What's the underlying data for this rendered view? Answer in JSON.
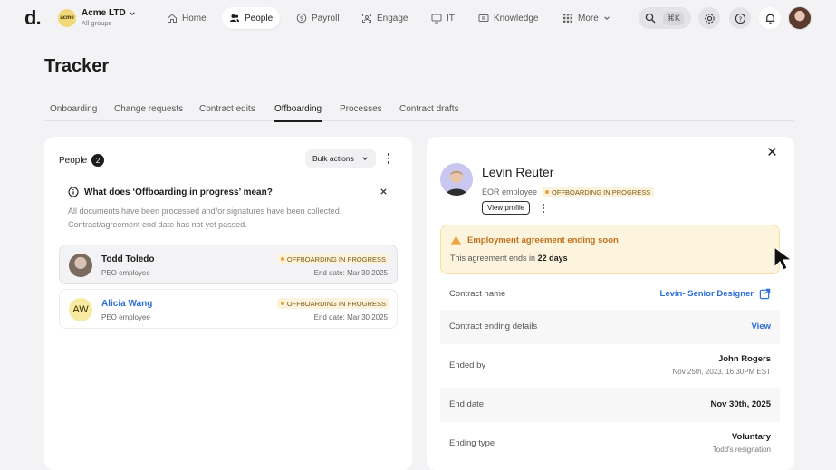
{
  "nav": {
    "logo": "d.",
    "org_badge": "acme",
    "org_name": "Acme LTD",
    "org_sub": "All groups",
    "items": [
      {
        "label": "Home"
      },
      {
        "label": "People"
      },
      {
        "label": "Payroll"
      },
      {
        "label": "Engage"
      },
      {
        "label": "IT"
      },
      {
        "label": "Knowledge"
      },
      {
        "label": "More"
      }
    ],
    "search_shortcut": "⌘K"
  },
  "page": {
    "title": "Tracker",
    "tabs": [
      "Onboarding",
      "Change requests",
      "Contract edits",
      "Offboarding",
      "Processes",
      "Contract drafts"
    ],
    "active_tab": "Offboarding"
  },
  "people_panel": {
    "label": "People",
    "count": "2",
    "bulk_actions": "Bulk actions",
    "info_title": "What does ‘Offboarding in progress’ mean?",
    "info_line1": "All documents have been processed and/or signatures have been collected.",
    "info_line2": "Contract/agreement end date has not yet passed.",
    "people": [
      {
        "initials": "",
        "name": "Todd Toledo",
        "role": "PEO employee",
        "status": "OFFBOARDING IN PROGRESS",
        "end_date": "End date: Mar 30 2025"
      },
      {
        "initials": "AW",
        "name": "Alicia Wang",
        "role": "PEO employee",
        "status": "OFFBOARDING IN PROGRESS",
        "end_date": "End date: Mar 30 2025"
      }
    ]
  },
  "detail": {
    "name": "Levin Reuter",
    "type": "EOR employee",
    "status": "OFFBOARDING IN PROGRESS",
    "view_profile": "View profile",
    "warning_title": "Employment agreement ending soon",
    "warning_prefix": "This agreement ends in",
    "warning_days": "22 days",
    "rows": {
      "contract_name_label": "Contract name",
      "contract_name_value": "Levin- Senior Designer",
      "ending_details_label": "Contract ending details",
      "ending_details_value": "View",
      "ended_by_label": "Ended by",
      "ended_by_value": "John Rogers",
      "ended_by_time": "Nov 25th, 2023, 16:30PM EST",
      "end_date_label": "End date",
      "end_date_value": "Nov 30th, 2025",
      "ending_type_label": "Ending type",
      "ending_type_value": "Voluntary",
      "ending_type_sub": "Todd's resignation"
    }
  },
  "colors": {
    "accent_link": "#2c6ed6",
    "status_bg": "#fdf3dc",
    "status_dot": "#e8a33b",
    "warning_text": "#c0701a"
  }
}
